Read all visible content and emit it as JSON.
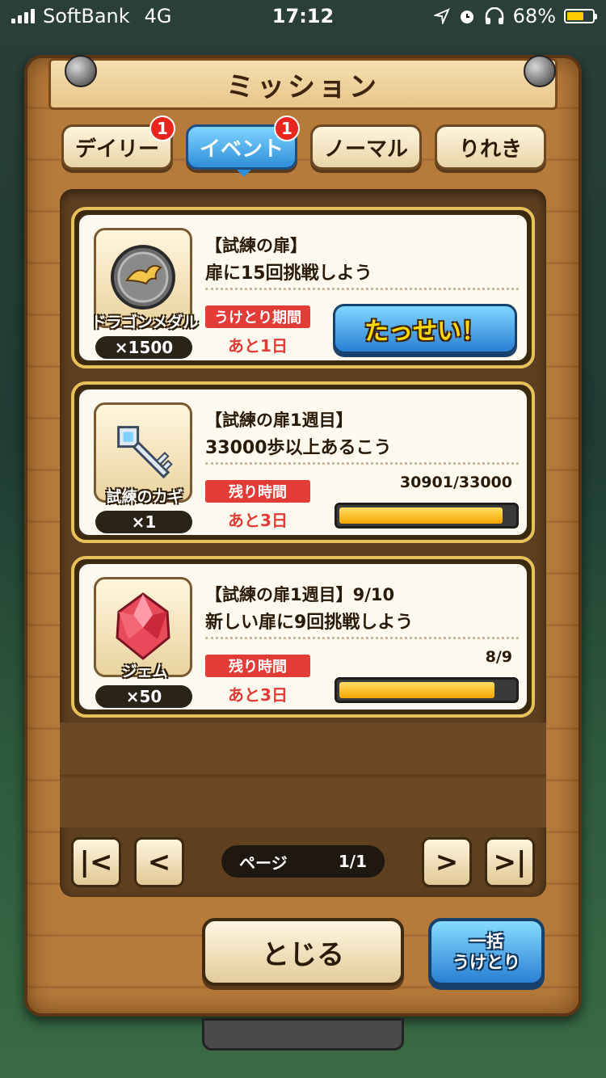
{
  "status_bar": {
    "carrier": "SoftBank",
    "network": "4G",
    "time": "17:12",
    "battery": "68%",
    "battery_level": 0.68
  },
  "header": {
    "title": "ミッション"
  },
  "tabs": [
    {
      "label": "デイリー",
      "badge": "1",
      "active": false
    },
    {
      "label": "イベント",
      "badge": "1",
      "active": true
    },
    {
      "label": "ノーマル",
      "badge": "",
      "active": false
    },
    {
      "label": "りれき",
      "badge": "",
      "active": false
    }
  ],
  "missions": [
    {
      "reward_name": "ドラゴンメダル",
      "reward_qty": "×1500",
      "reward_icon": "dragon-medal-icon",
      "title": "【試練の扉】",
      "desc": "扉に15回挑戦しよう",
      "period_label": "うけとり期間",
      "period_value": "あと1日",
      "action_label": "たっせい！"
    },
    {
      "reward_name": "試練のカギ",
      "reward_qty": "×1",
      "reward_icon": "key-icon",
      "title": "【試練の扉1週目】",
      "desc": "33000歩以上あるこう",
      "period_label": "残り時間",
      "period_value": "あと3日",
      "progress_text": "30901/33000",
      "progress": 0.936
    },
    {
      "reward_name": "ジェム",
      "reward_qty": "×50",
      "reward_icon": "gem-icon",
      "title": "【試練の扉1週目】9/10",
      "desc": "新しい扉に9回挑戦しよう",
      "period_label": "残り時間",
      "period_value": "あと3日",
      "progress_text": "8/9",
      "progress": 0.889
    }
  ],
  "pager": {
    "label": "ページ",
    "value": "1/1",
    "first": "|<",
    "prev": "<",
    "next": ">",
    "last": ">|"
  },
  "footer": {
    "close_label": "とじる",
    "claim_line1": "一括",
    "claim_line2": "うけとり"
  }
}
